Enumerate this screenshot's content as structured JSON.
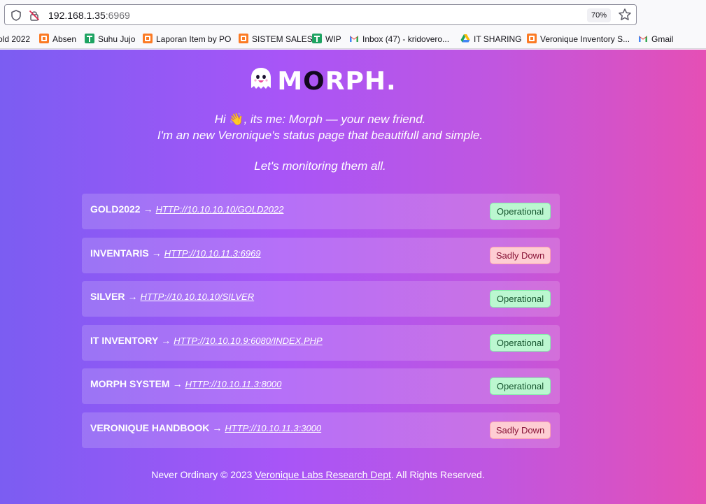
{
  "browser": {
    "url_host": "192.168.1.35",
    "url_port": ":6969",
    "zoom": "70%"
  },
  "bookmarks": [
    {
      "label": "old 2022",
      "icon": "xampp-icon"
    },
    {
      "label": "Absen",
      "icon": "xampp-icon"
    },
    {
      "label": "Suhu Jujo",
      "icon": "sheets-icon"
    },
    {
      "label": "Laporan Item by PO",
      "icon": "xampp-icon"
    },
    {
      "label": "SISTEM SALES",
      "icon": "xampp-icon"
    },
    {
      "label": "WIP",
      "icon": "sheets-icon"
    },
    {
      "label": "Inbox (47) - kridovero...",
      "icon": "gmail-icon"
    },
    {
      "label": "IT SHARING",
      "icon": "drive-icon"
    },
    {
      "label": "Veronique Inventory S...",
      "icon": "xampp-icon"
    },
    {
      "label": "Gmail",
      "icon": "gmail-icon"
    }
  ],
  "brand": {
    "prefix": "M",
    "o": "O",
    "suffix": "RPH."
  },
  "tagline": {
    "line1_pre": "Hi ",
    "wave": "👋",
    "line1_post": ", its me: Morph — your new friend.",
    "line2": "I'm an new Veronique's status page that beautifull and simple.",
    "line3": "Let's monitoring them all."
  },
  "services": [
    {
      "name": "GOLD2022",
      "url": "http://10.10.10.10/gold2022",
      "status": "Operational",
      "state": "up"
    },
    {
      "name": "INVENTARIS",
      "url": "http://10.10.11.3:6969",
      "status": "Sadly Down",
      "state": "down"
    },
    {
      "name": "SILVER",
      "url": "http://10.10.10.10/silver",
      "status": "Operational",
      "state": "up"
    },
    {
      "name": "IT INVENTORY",
      "url": "http://10.10.10.9:6080/index.php",
      "status": "Operational",
      "state": "up"
    },
    {
      "name": "MORPH SYSTEM",
      "url": "http://10.10.11.3:8000",
      "status": "Operational",
      "state": "up"
    },
    {
      "name": "VERONIQUE HANDBOOK",
      "url": "http://10.10.11.3:3000",
      "status": "Sadly Down",
      "state": "down"
    }
  ],
  "arrow": "→",
  "footer": {
    "pre": "Never Ordinary © 2023 ",
    "link": "Veronique Labs Research Dept",
    "post": ". All Rights Reserved."
  },
  "colors": {
    "gradient_start": "#7b5df2",
    "gradient_end": "#e54fb5",
    "operational_bg": "#bbf7d0",
    "down_bg": "#fecdd3"
  }
}
